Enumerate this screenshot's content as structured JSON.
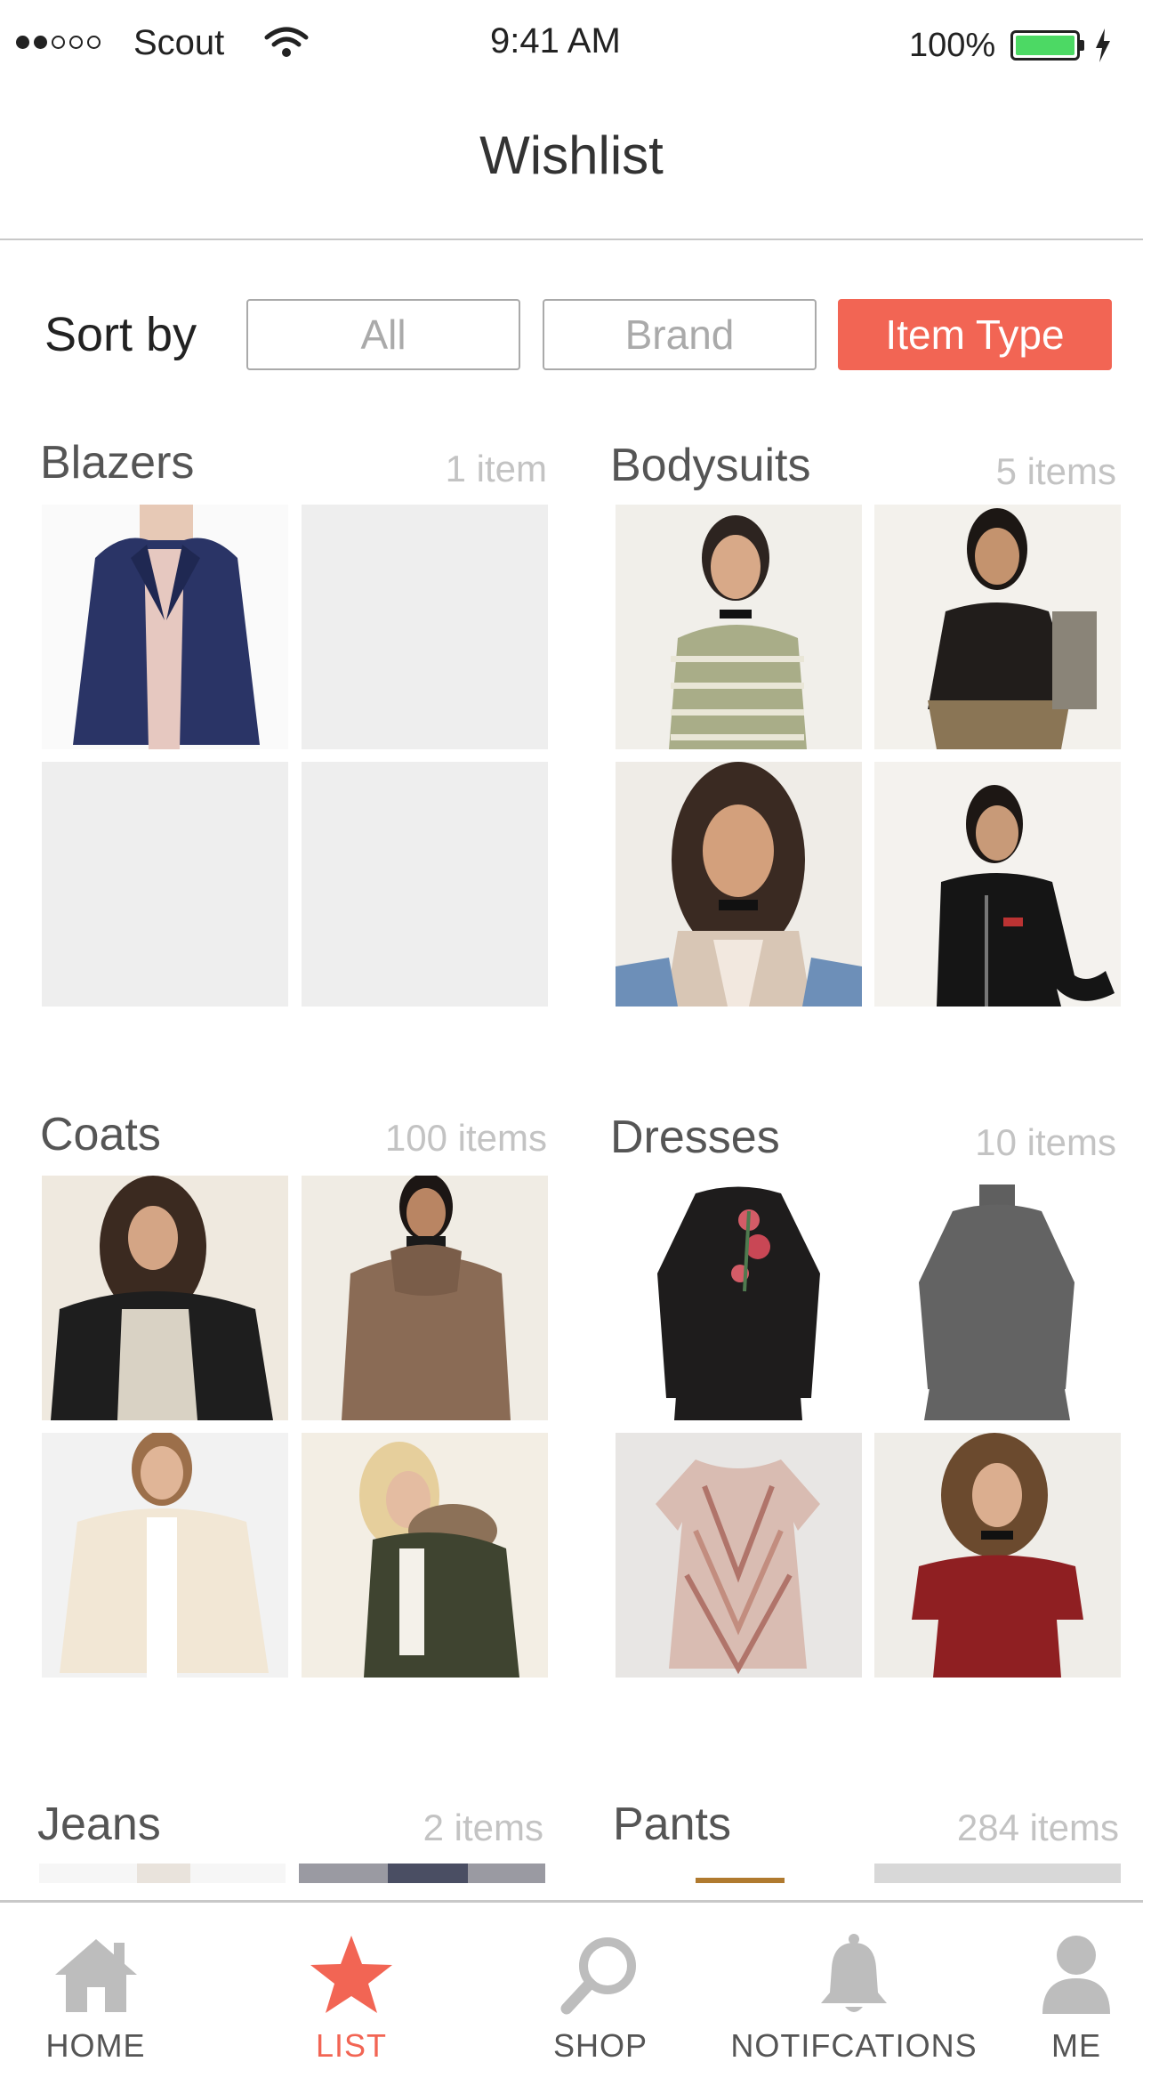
{
  "status_bar": {
    "carrier": "Scout",
    "time": "9:41 AM",
    "battery_percent": "100%",
    "signal_bars_filled": 2,
    "signal_bars_total": 5
  },
  "header": {
    "title": "Wishlist"
  },
  "sort": {
    "label": "Sort by",
    "options": [
      "All",
      "Brand",
      "Item Type"
    ],
    "selected": "Item Type"
  },
  "categories": [
    {
      "name": "Blazers",
      "count": "1 item"
    },
    {
      "name": "Bodysuits",
      "count": "5 items"
    },
    {
      "name": "Coats",
      "count": "100 items"
    },
    {
      "name": "Dresses",
      "count": "10 items"
    },
    {
      "name": "Jeans",
      "count": "2 items"
    },
    {
      "name": "Pants",
      "count": "284 items"
    }
  ],
  "tab_bar": {
    "items": [
      {
        "label": "HOME",
        "icon": "home-icon"
      },
      {
        "label": "LIST",
        "icon": "star-icon"
      },
      {
        "label": "SHOP",
        "icon": "search-icon"
      },
      {
        "label": "NOTIFCATIONS",
        "icon": "bell-icon"
      },
      {
        "label": "ME",
        "icon": "person-icon"
      }
    ],
    "active": "LIST"
  },
  "colors": {
    "accent": "#f26554",
    "placeholder": "#eeeeee",
    "muted": "#c3c3c3"
  }
}
